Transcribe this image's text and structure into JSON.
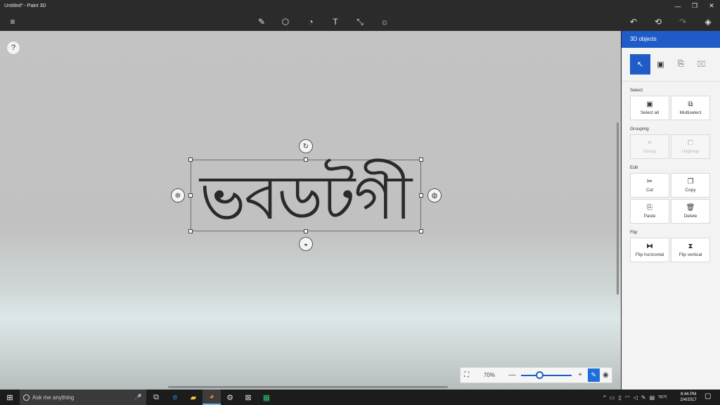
{
  "window": {
    "title": "Untitled* - Paint 3D",
    "minimize": "—",
    "restore": "❐",
    "close": "✕"
  },
  "toolbar": {
    "menu_icon": "≡",
    "tools": [
      {
        "name": "brush-icon",
        "glyph": "✎"
      },
      {
        "name": "3d-shapes-icon",
        "glyph": "⬡"
      },
      {
        "name": "stickers-icon",
        "glyph": "◔"
      },
      {
        "name": "text-icon",
        "glyph": "T"
      },
      {
        "name": "canvas-icon",
        "glyph": "⤡"
      },
      {
        "name": "effects-icon",
        "glyph": "☼"
      }
    ],
    "undo": "↶",
    "history": "⟲",
    "redo": "↷",
    "remix3d": "◈"
  },
  "canvas": {
    "help": "?",
    "text_object": "ভবডটগী",
    "rotate_gizmo": "↻",
    "left_gizmo": "⊕",
    "right_gizmo": "◍",
    "bottom_gizmo": "◒"
  },
  "zoom": {
    "fit_icon": "⛶",
    "percent": "70%",
    "minus": "—",
    "plus": "+",
    "level": 0.35,
    "pen_icon": "✎",
    "view_icon": "◉"
  },
  "panel": {
    "title": "3D objects",
    "tools": [
      {
        "name": "select-tool-icon",
        "glyph": "↖",
        "active": true
      },
      {
        "name": "magic-select-icon",
        "glyph": "▣",
        "active": false
      },
      {
        "name": "paste-tool-icon",
        "glyph": "⎘",
        "active": false
      },
      {
        "name": "crop-tool-icon",
        "glyph": "⌧",
        "active": false
      }
    ],
    "select_label": "Select",
    "select_all": "Select all",
    "multiselect": "Multiselect",
    "grouping_label": "Grouping",
    "group": "Group",
    "ungroup": "Ungroup",
    "edit_label": "Edit",
    "cut": "Cut",
    "copy": "Copy",
    "paste": "Paste",
    "delete": "Delete",
    "flip_label": "Flip",
    "flip_horizontal": "Flip horizontal",
    "flip_vertical": "Flip vertical"
  },
  "taskbar": {
    "search_placeholder": "Ask me anything",
    "time": "9:44 PM",
    "date": "2/4/2017",
    "lang": "অস"
  }
}
